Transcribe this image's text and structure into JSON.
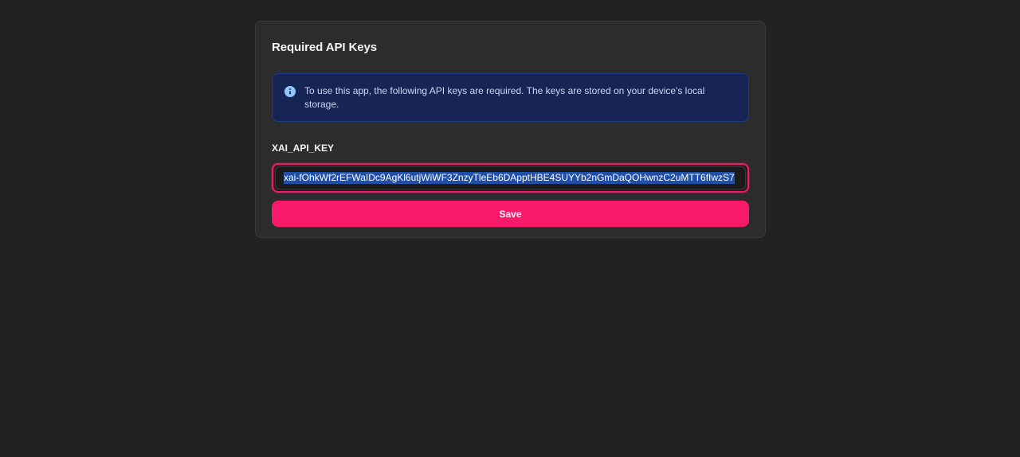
{
  "dialog": {
    "title": "Required API Keys",
    "info": {
      "icon": "info-icon",
      "text": "To use this app, the following API keys are required. The keys are stored on your device's local storage."
    },
    "fields": [
      {
        "label": "XAI_API_KEY",
        "value": "xai-fOhkWf2rEFWaIDc9AgKl6utjWiWF3ZnzyTleEb6DApptHBE4SUYYb2nGmDaQOHwnzC2uMTT6fIwzS7"
      }
    ],
    "save_label": "Save"
  },
  "colors": {
    "page_background": "#222222",
    "card_background": "#2c2c2d",
    "info_background": "#172554",
    "accent": "#f8196a",
    "selection": "#1f4fa8"
  }
}
